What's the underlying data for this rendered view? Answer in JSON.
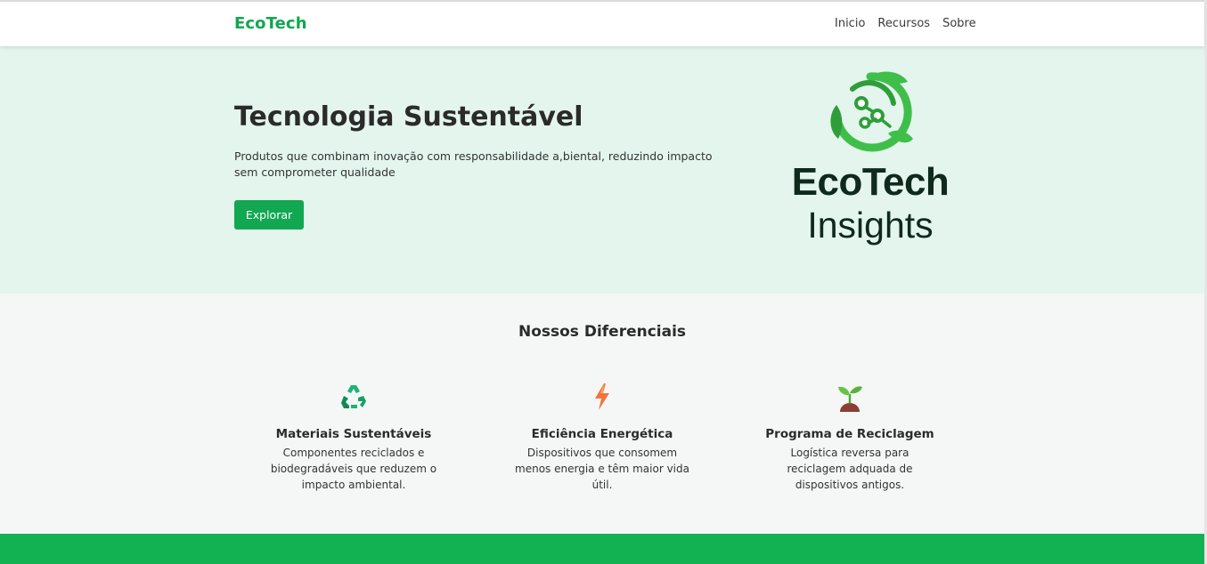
{
  "colors": {
    "accent": "#12a751",
    "hero_background": "#e4f5ee",
    "section_background": "#f5f7f6",
    "footer_band": "#12b253"
  },
  "nav": {
    "brand": "EcoTech",
    "links": [
      "Inicio",
      "Recursos",
      "Sobre"
    ]
  },
  "hero": {
    "title": "Tecnologia Sustentável",
    "description": "Produtos que combinam inovação com responsabilidade a,biental, reduzindo impacto sem comprometer qualidade",
    "button_label": "Explorar",
    "logo": {
      "word1": "EcoTech",
      "word2": "Insights",
      "emblem_icon": "circuit-leaf-icon"
    }
  },
  "features": {
    "title": "Nossos Diferenciais",
    "items": [
      {
        "icon": "recycle-icon",
        "title": "Materiais Sustentáveis",
        "description": "Componentes reciclados e biodegradáveis que reduzem o impacto ambiental."
      },
      {
        "icon": "lightning-icon",
        "title": "Eficiência Energética",
        "description": "Dispositivos que consomem menos energia e têm maior vida útil."
      },
      {
        "icon": "seedling-icon",
        "title": "Programa de Reciclagem",
        "description": "Logística reversa para reciclagem adquada de dispositivos antigos."
      }
    ]
  }
}
